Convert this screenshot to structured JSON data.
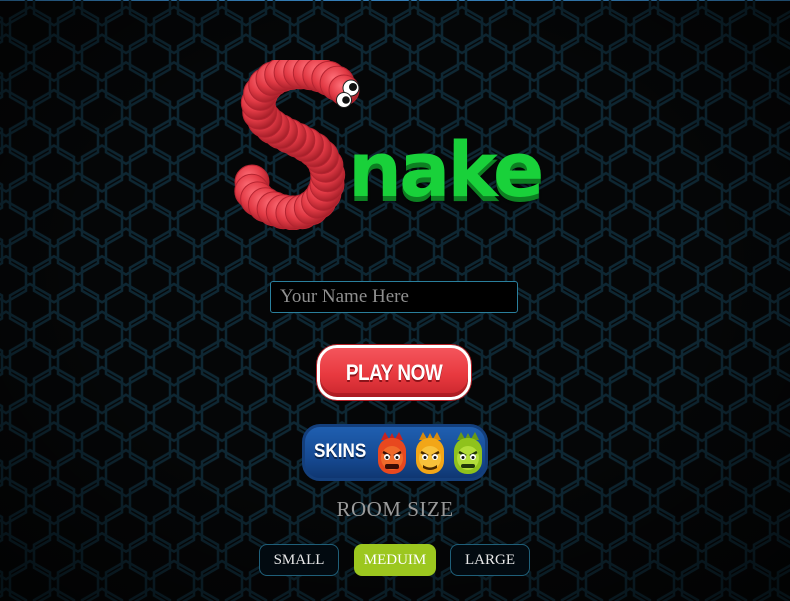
{
  "game": {
    "logo_letter": "S",
    "logo_text": "nake"
  },
  "name_input": {
    "placeholder": "Your Name Here",
    "value": ""
  },
  "play_button": {
    "label": "PLAY NOW"
  },
  "skins_button": {
    "label": "SKINS"
  },
  "room_size": {
    "title": "ROOM SIZE",
    "options": [
      {
        "label": "SMALL",
        "selected": false
      },
      {
        "label": "MEDUIM",
        "selected": true
      },
      {
        "label": "LARGE",
        "selected": false
      }
    ]
  },
  "colors": {
    "background": "#050607",
    "hex_grid": "#0e2733",
    "snake_red": "#e23a45",
    "logo_green": "#19d13a",
    "play_red": "#e8393f",
    "skins_blue": "#164a93",
    "selected_green": "#9cc71f"
  }
}
